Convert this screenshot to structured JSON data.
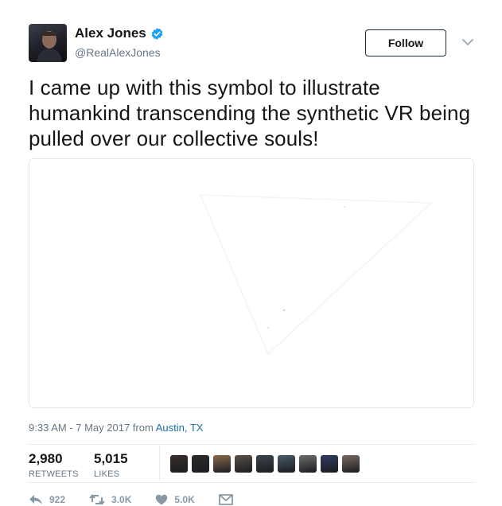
{
  "author": {
    "name": "Alex Jones",
    "handle": "@RealAlexJones"
  },
  "follow_label": "Follow",
  "tweet_text": "I came up with this symbol to illustrate humankind transcending the synthetic VR being pulled over our collective souls!",
  "meta": {
    "time": "9:33 AM - 7 May 2017 from ",
    "place": "Austin, TX"
  },
  "stats": {
    "retweets": {
      "value": "2,980",
      "label": "RETWEETS"
    },
    "likes": {
      "value": "5,015",
      "label": "LIKES"
    }
  },
  "liker_avatar_colors": [
    "#3a2e2a",
    "#2b2b2b",
    "#8a6a4a",
    "#5a5148",
    "#3d4550",
    "#4a5a6a",
    "#6d6d6d",
    "#2f3d5e",
    "#7a6a60"
  ],
  "actions": {
    "reply_count": "922",
    "retweet_count": "3.0K",
    "like_count": "5.0K"
  },
  "colors": {
    "verified": "#1da1f2",
    "link": "#1b6fa8",
    "muted": "#657786"
  }
}
